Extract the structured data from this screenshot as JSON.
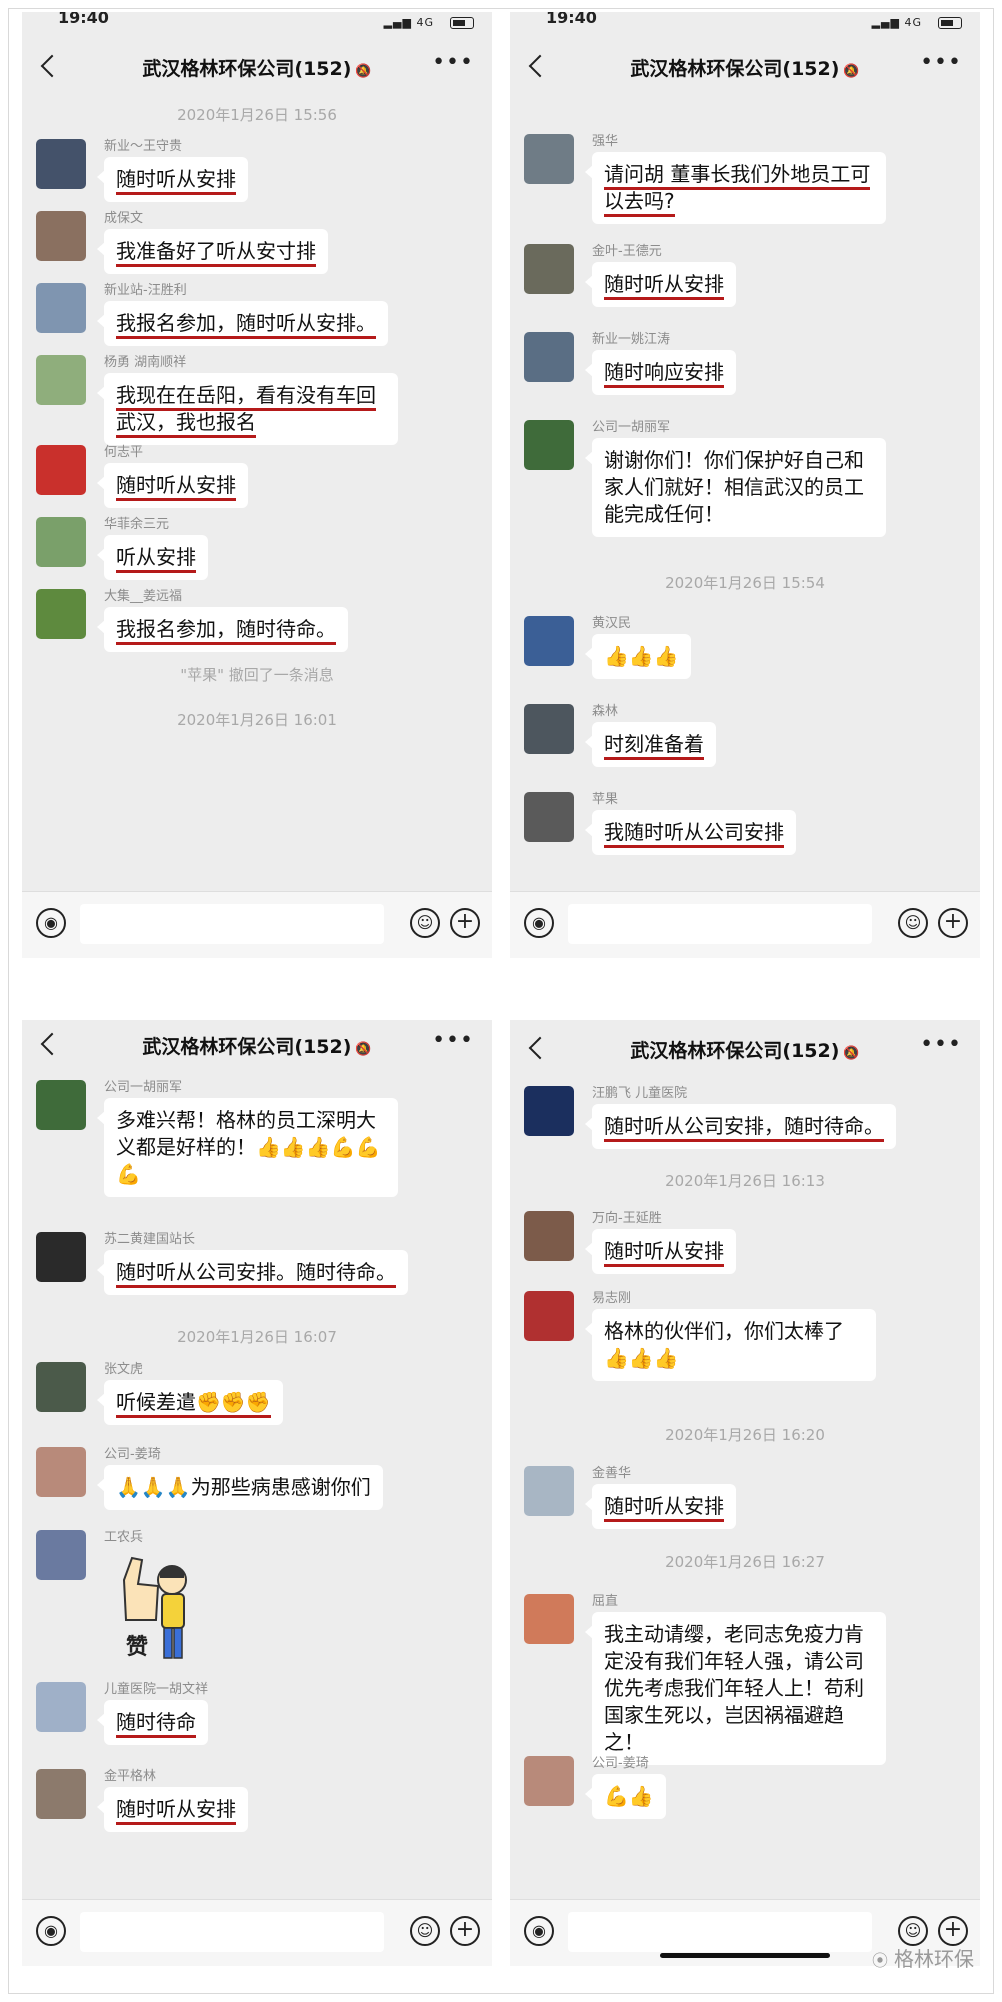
{
  "title": "武汉格林环保公司(152)",
  "status_time": "19:40",
  "status_network": "4G",
  "panels": [
    {
      "items": [
        {
          "t": "ts",
          "text": "2020年1月26日 15:56"
        },
        {
          "t": "msg",
          "sender": "新业～王守贵",
          "text": "随时听从安排",
          "av": "#44526a"
        },
        {
          "t": "msg",
          "sender": "成保文",
          "text": "我准备好了听从安寸排",
          "av": "#8a7060"
        },
        {
          "t": "msg",
          "sender": "新业站-汪胜利",
          "text": "我报名参加，随时听从安排。",
          "av": "#7f95b0"
        },
        {
          "t": "msg",
          "sender": "杨勇 湖南顺祥",
          "text": "我现在在岳阳，看有没有车回武汉，我也报名",
          "av": "#8fae7c"
        },
        {
          "t": "msg",
          "sender": "何志平",
          "text": "随时听从安排",
          "av": "#c9302c"
        },
        {
          "t": "msg",
          "sender": "华菲余三元",
          "text": "听从安排",
          "av": "#7aa06a"
        },
        {
          "t": "msg",
          "sender": "大集__姜远福",
          "text": "我报名参加，随时待命。",
          "av": "#5e8a3e"
        },
        {
          "t": "recall",
          "text": "\"苹果\" 撤回了一条消息"
        },
        {
          "t": "ts",
          "text": "2020年1月26日 16:01"
        }
      ]
    },
    {
      "items": [
        {
          "t": "msg",
          "sender": "强华",
          "text": "请问胡 董事长我们外地员工可以去吗?",
          "av": "#6f7c86"
        },
        {
          "t": "msg",
          "sender": "金叶-王德元",
          "text": "随时听从安排",
          "av": "#6a6a5c"
        },
        {
          "t": "msg",
          "sender": "新业一姚江涛",
          "text": "随时响应安排",
          "av": "#5a6e84"
        },
        {
          "t": "msg",
          "sender": "公司一胡丽军",
          "text": "谢谢你们！你们保护好自己和家人们就好！相信武汉的员工能完成任何！",
          "av": "#3f6b3a"
        },
        {
          "t": "ts",
          "text": "2020年1月26日 15:54"
        },
        {
          "t": "msg",
          "sender": "黄汉民",
          "text": "👍👍👍",
          "av": "#3b5f96"
        },
        {
          "t": "msg",
          "sender": "森林",
          "text": "时刻准备着",
          "av": "#4d565e"
        },
        {
          "t": "msg",
          "sender": "苹果",
          "text": "我随时听从公司安排",
          "av": "#5a5a5a"
        }
      ]
    },
    {
      "items": [
        {
          "t": "msg",
          "sender": "公司一胡丽军",
          "text": "多难兴帮！格林的员工深明大义都是好样的！👍👍👍💪💪💪",
          "av": "#3f6b3a"
        },
        {
          "t": "msg",
          "sender": "苏二黄建国站长",
          "text": "随时听从公司安排。随时待命。",
          "av": "#2a2a2a"
        },
        {
          "t": "ts",
          "text": "2020年1月26日 16:07"
        },
        {
          "t": "msg",
          "sender": "张文虎",
          "text": "听候差遣✊✊✊",
          "av": "#4b5a4a"
        },
        {
          "t": "msg",
          "sender": "公司-姜琦",
          "text": "🙏🙏🙏为那些病患感谢你们",
          "av": "#b88a7a"
        },
        {
          "t": "sticker",
          "sender": "工农兵",
          "text": "赞",
          "av": "#6a7aa0"
        },
        {
          "t": "msg",
          "sender": "儿童医院一胡文祥",
          "text": "随时待命",
          "av": "#9fb0c8"
        },
        {
          "t": "msg",
          "sender": "金平格林",
          "text": "随时听从安排",
          "av": "#8c7a6c"
        }
      ]
    },
    {
      "items": [
        {
          "t": "msg",
          "sender": "汪鹏飞 儿童医院",
          "text": "随时听从公司安排，随时待命。",
          "av": "#1b2f5e"
        },
        {
          "t": "ts",
          "text": "2020年1月26日 16:13"
        },
        {
          "t": "msg",
          "sender": "万向-王延胜",
          "text": "随时听从安排",
          "av": "#7c5b4a"
        },
        {
          "t": "msg",
          "sender": "易志刚",
          "text": "格林的伙伴们，你们太棒了👍👍👍",
          "av": "#b03030"
        },
        {
          "t": "ts",
          "text": "2020年1月26日 16:20"
        },
        {
          "t": "msg",
          "sender": "金善华",
          "text": "随时听从安排",
          "av": "#a8b6c4"
        },
        {
          "t": "ts",
          "text": "2020年1月26日 16:27"
        },
        {
          "t": "msg",
          "sender": "屈直",
          "text": "我主动请缨，老同志免疫力肯定没有我们年轻人强，请公司优先考虑我们年轻人上！苟利国家生死以，岂因祸福避趋之！",
          "av": "#d07a5a"
        },
        {
          "t": "msg",
          "sender": "公司-姜琦",
          "text": "💪👍",
          "av": "#b88a7a"
        }
      ]
    }
  ],
  "watermark": "格林环保"
}
